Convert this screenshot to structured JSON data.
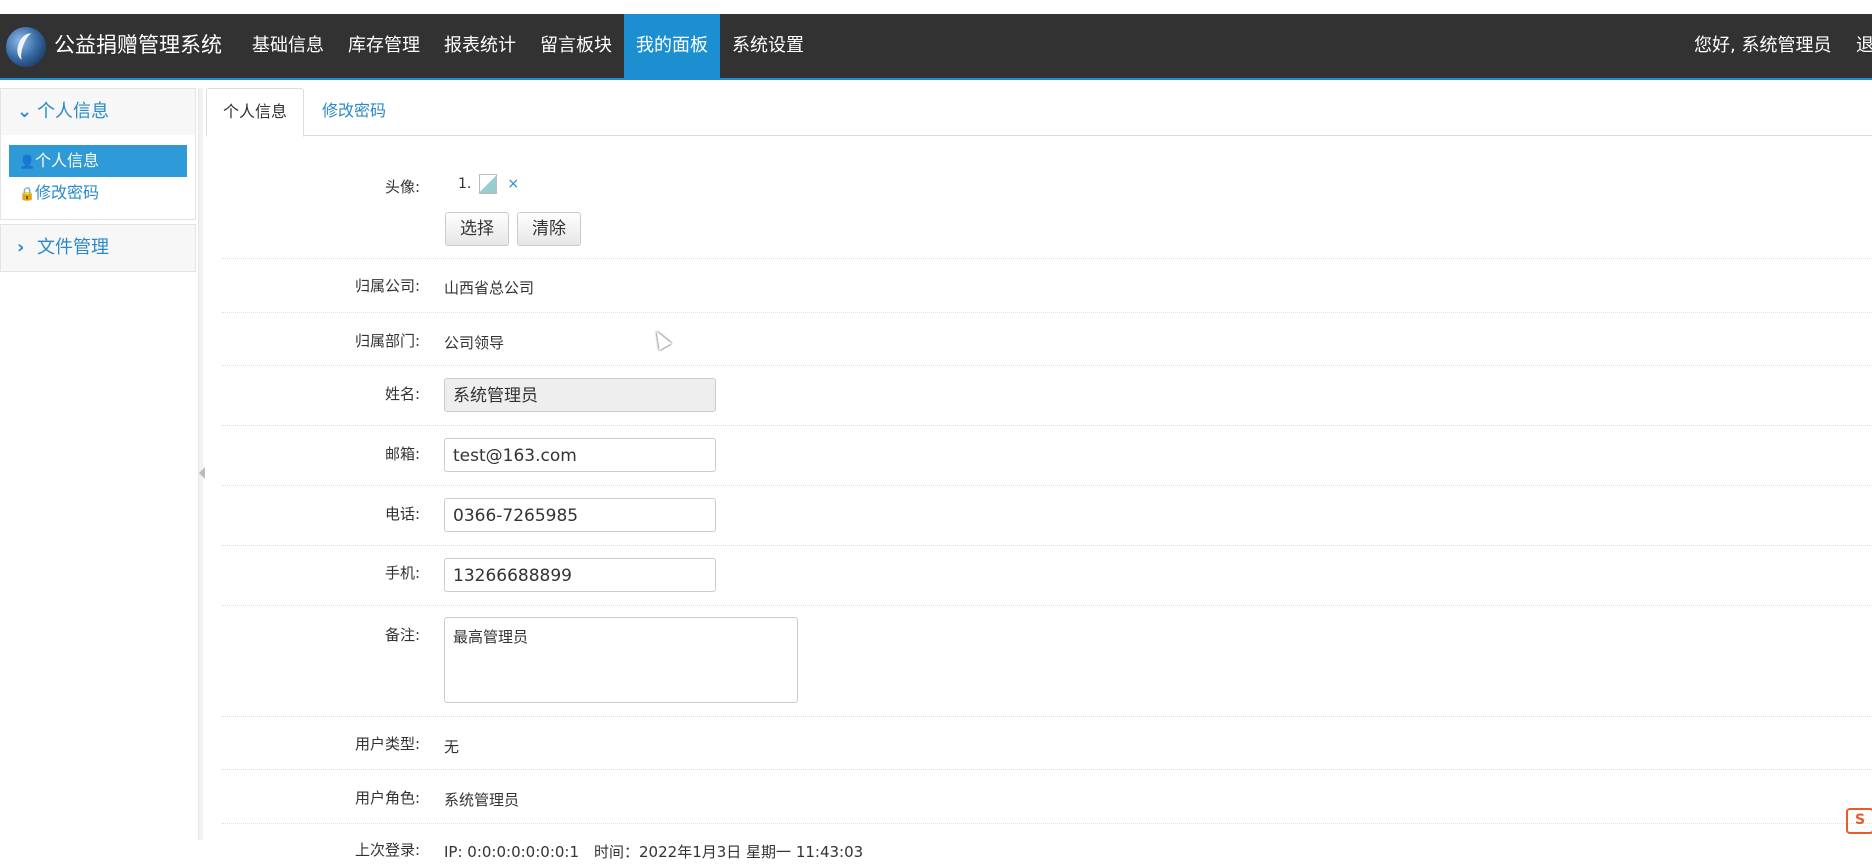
{
  "app": {
    "brand": "公益捐赠管理系统"
  },
  "nav": {
    "items": [
      {
        "label": "基础信息"
      },
      {
        "label": "库存管理"
      },
      {
        "label": "报表统计"
      },
      {
        "label": "留言板块"
      },
      {
        "label": "我的面板",
        "active": true
      },
      {
        "label": "系统设置"
      }
    ],
    "greeting": "您好, 系统管理员",
    "logout": "退"
  },
  "sidebar": {
    "groups": [
      {
        "title": "个人信息",
        "expanded": true,
        "items": [
          {
            "label": "个人信息",
            "icon": "user-icon",
            "active": true
          },
          {
            "label": "修改密码",
            "icon": "lock-icon"
          }
        ]
      },
      {
        "title": "文件管理",
        "expanded": false
      }
    ]
  },
  "tabs": [
    {
      "label": "个人信息",
      "active": true
    },
    {
      "label": "修改密码"
    }
  ],
  "form": {
    "avatar": {
      "label": "头像:",
      "item_index": "1.",
      "remove": "×",
      "select": "选择",
      "clear": "清除"
    },
    "company": {
      "label": "归属公司:",
      "value": "山西省总公司"
    },
    "department": {
      "label": "归属部门:",
      "value": "公司领导"
    },
    "name": {
      "label": "姓名:",
      "value": "系统管理员"
    },
    "email": {
      "label": "邮箱:",
      "value": "test@163.com"
    },
    "phone": {
      "label": "电话:",
      "value": "0366-7265985"
    },
    "mobile": {
      "label": "手机:",
      "value": "13266688899"
    },
    "remarks": {
      "label": "备注:",
      "value": "最高管理员"
    },
    "user_type": {
      "label": "用户类型:",
      "value": "无"
    },
    "user_role": {
      "label": "用户角色:",
      "value": "系统管理员"
    },
    "last_login": {
      "label": "上次登录:",
      "value": "IP: 0:0:0:0:0:0:0:1　时间：2022年1月3日 星期一 11:43:03"
    }
  },
  "colors": {
    "navbar": "#323232",
    "accent": "#1b8fcf",
    "link": "#2a8ac9"
  }
}
